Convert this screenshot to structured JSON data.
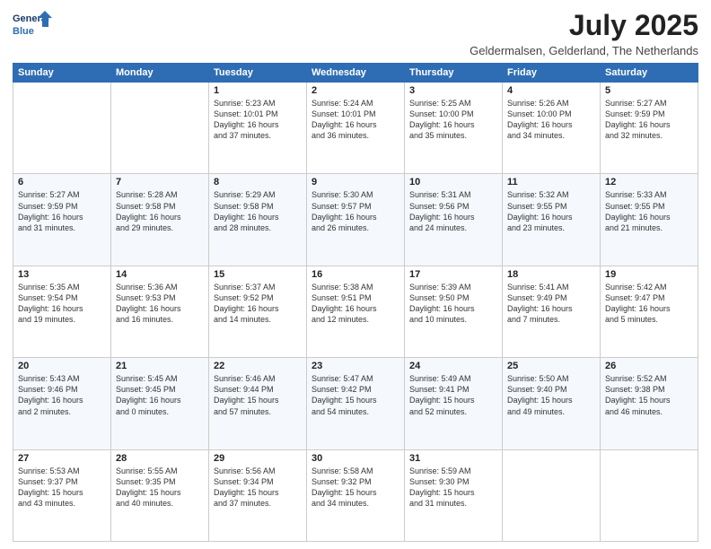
{
  "header": {
    "logo_line1": "General",
    "logo_line2": "Blue",
    "month": "July 2025",
    "location": "Geldermalsen, Gelderland, The Netherlands"
  },
  "days_of_week": [
    "Sunday",
    "Monday",
    "Tuesday",
    "Wednesday",
    "Thursday",
    "Friday",
    "Saturday"
  ],
  "weeks": [
    [
      {
        "day": "",
        "info": ""
      },
      {
        "day": "",
        "info": ""
      },
      {
        "day": "1",
        "info": "Sunrise: 5:23 AM\nSunset: 10:01 PM\nDaylight: 16 hours\nand 37 minutes."
      },
      {
        "day": "2",
        "info": "Sunrise: 5:24 AM\nSunset: 10:01 PM\nDaylight: 16 hours\nand 36 minutes."
      },
      {
        "day": "3",
        "info": "Sunrise: 5:25 AM\nSunset: 10:00 PM\nDaylight: 16 hours\nand 35 minutes."
      },
      {
        "day": "4",
        "info": "Sunrise: 5:26 AM\nSunset: 10:00 PM\nDaylight: 16 hours\nand 34 minutes."
      },
      {
        "day": "5",
        "info": "Sunrise: 5:27 AM\nSunset: 9:59 PM\nDaylight: 16 hours\nand 32 minutes."
      }
    ],
    [
      {
        "day": "6",
        "info": "Sunrise: 5:27 AM\nSunset: 9:59 PM\nDaylight: 16 hours\nand 31 minutes."
      },
      {
        "day": "7",
        "info": "Sunrise: 5:28 AM\nSunset: 9:58 PM\nDaylight: 16 hours\nand 29 minutes."
      },
      {
        "day": "8",
        "info": "Sunrise: 5:29 AM\nSunset: 9:58 PM\nDaylight: 16 hours\nand 28 minutes."
      },
      {
        "day": "9",
        "info": "Sunrise: 5:30 AM\nSunset: 9:57 PM\nDaylight: 16 hours\nand 26 minutes."
      },
      {
        "day": "10",
        "info": "Sunrise: 5:31 AM\nSunset: 9:56 PM\nDaylight: 16 hours\nand 24 minutes."
      },
      {
        "day": "11",
        "info": "Sunrise: 5:32 AM\nSunset: 9:55 PM\nDaylight: 16 hours\nand 23 minutes."
      },
      {
        "day": "12",
        "info": "Sunrise: 5:33 AM\nSunset: 9:55 PM\nDaylight: 16 hours\nand 21 minutes."
      }
    ],
    [
      {
        "day": "13",
        "info": "Sunrise: 5:35 AM\nSunset: 9:54 PM\nDaylight: 16 hours\nand 19 minutes."
      },
      {
        "day": "14",
        "info": "Sunrise: 5:36 AM\nSunset: 9:53 PM\nDaylight: 16 hours\nand 16 minutes."
      },
      {
        "day": "15",
        "info": "Sunrise: 5:37 AM\nSunset: 9:52 PM\nDaylight: 16 hours\nand 14 minutes."
      },
      {
        "day": "16",
        "info": "Sunrise: 5:38 AM\nSunset: 9:51 PM\nDaylight: 16 hours\nand 12 minutes."
      },
      {
        "day": "17",
        "info": "Sunrise: 5:39 AM\nSunset: 9:50 PM\nDaylight: 16 hours\nand 10 minutes."
      },
      {
        "day": "18",
        "info": "Sunrise: 5:41 AM\nSunset: 9:49 PM\nDaylight: 16 hours\nand 7 minutes."
      },
      {
        "day": "19",
        "info": "Sunrise: 5:42 AM\nSunset: 9:47 PM\nDaylight: 16 hours\nand 5 minutes."
      }
    ],
    [
      {
        "day": "20",
        "info": "Sunrise: 5:43 AM\nSunset: 9:46 PM\nDaylight: 16 hours\nand 2 minutes."
      },
      {
        "day": "21",
        "info": "Sunrise: 5:45 AM\nSunset: 9:45 PM\nDaylight: 16 hours\nand 0 minutes."
      },
      {
        "day": "22",
        "info": "Sunrise: 5:46 AM\nSunset: 9:44 PM\nDaylight: 15 hours\nand 57 minutes."
      },
      {
        "day": "23",
        "info": "Sunrise: 5:47 AM\nSunset: 9:42 PM\nDaylight: 15 hours\nand 54 minutes."
      },
      {
        "day": "24",
        "info": "Sunrise: 5:49 AM\nSunset: 9:41 PM\nDaylight: 15 hours\nand 52 minutes."
      },
      {
        "day": "25",
        "info": "Sunrise: 5:50 AM\nSunset: 9:40 PM\nDaylight: 15 hours\nand 49 minutes."
      },
      {
        "day": "26",
        "info": "Sunrise: 5:52 AM\nSunset: 9:38 PM\nDaylight: 15 hours\nand 46 minutes."
      }
    ],
    [
      {
        "day": "27",
        "info": "Sunrise: 5:53 AM\nSunset: 9:37 PM\nDaylight: 15 hours\nand 43 minutes."
      },
      {
        "day": "28",
        "info": "Sunrise: 5:55 AM\nSunset: 9:35 PM\nDaylight: 15 hours\nand 40 minutes."
      },
      {
        "day": "29",
        "info": "Sunrise: 5:56 AM\nSunset: 9:34 PM\nDaylight: 15 hours\nand 37 minutes."
      },
      {
        "day": "30",
        "info": "Sunrise: 5:58 AM\nSunset: 9:32 PM\nDaylight: 15 hours\nand 34 minutes."
      },
      {
        "day": "31",
        "info": "Sunrise: 5:59 AM\nSunset: 9:30 PM\nDaylight: 15 hours\nand 31 minutes."
      },
      {
        "day": "",
        "info": ""
      },
      {
        "day": "",
        "info": ""
      }
    ]
  ]
}
